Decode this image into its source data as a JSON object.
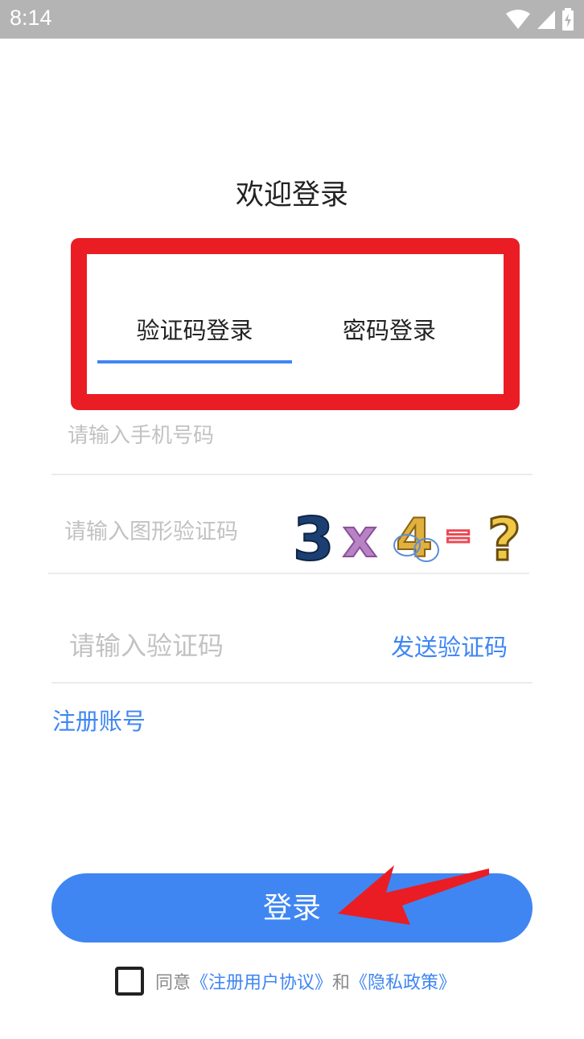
{
  "status_bar": {
    "time": "8:14"
  },
  "title": "欢迎登录",
  "tabs": [
    {
      "label": "验证码登录",
      "active": true
    },
    {
      "label": "密码登录",
      "active": false
    }
  ],
  "form": {
    "phone_placeholder": "请输入手机号码",
    "captcha_placeholder": "请输入图形验证码",
    "code_placeholder": "请输入验证码",
    "send_code_label": "发送验证码"
  },
  "register_label": "注册账号",
  "login_label": "登录",
  "agreement": {
    "prefix": "同意",
    "user_agreement": "《注册用户协议》",
    "and": "和",
    "privacy": "《隐私政策》"
  },
  "colors": {
    "accent": "#3f86f2",
    "highlight": "#ea1d24",
    "status_bar": "#b4b4b4"
  }
}
